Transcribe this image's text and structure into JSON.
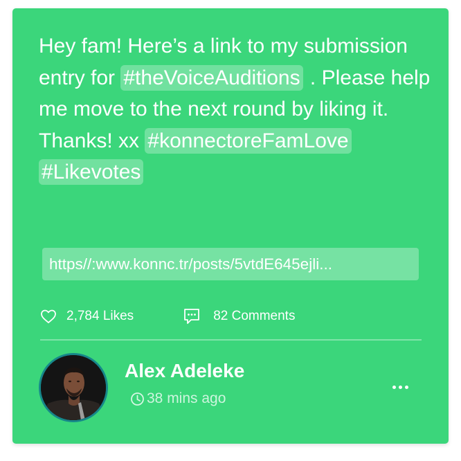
{
  "post": {
    "text_part1": "Hey fam! Here’s a link to my submission entry for ",
    "hashtag1": "#theVoiceAuditions",
    "text_part2": " . Please help me move to the next round by liking it. Thanks! xx ",
    "hashtag2": "#konnectoreFamLove",
    "hashtag3": "#Likevotes",
    "link": "https//:www.konnc.tr/posts/5vtdE645ejli..."
  },
  "stats": {
    "likes_label": "2,784 Likes",
    "comments_label": "82 Comments",
    "like_icon": "heart-outline",
    "comment_icon": "chat-bubble-dots"
  },
  "author": {
    "name": "Alex Adeleke",
    "time": "38 mins ago",
    "time_icon": "clock"
  },
  "colors": {
    "card_bg": "#3bd67b",
    "text": "#ffffff",
    "avatar_ring": "#16878a"
  }
}
